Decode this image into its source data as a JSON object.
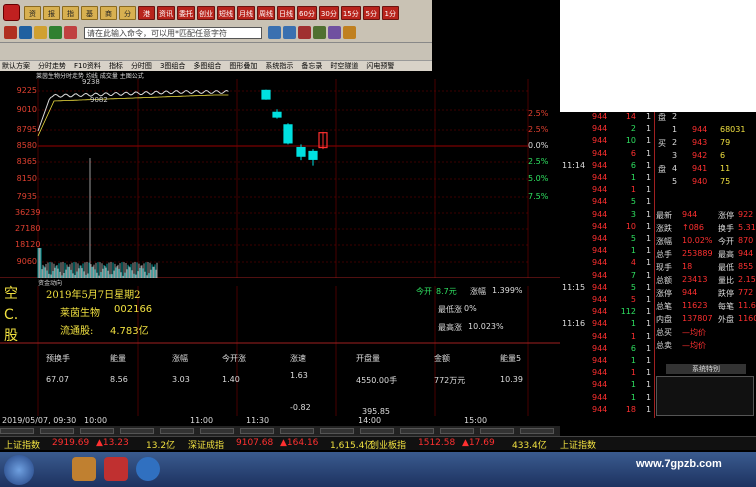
{
  "toolbar": {
    "row1": [
      "资",
      "报",
      "指",
      "基",
      "商",
      "分",
      "港",
      "资讯",
      "委托",
      "创业",
      "短线",
      "月线",
      "周线",
      "日线",
      "60分",
      "30分",
      "15分",
      "5分",
      "1分"
    ],
    "row2_icons": [
      "menu-icon",
      "back-icon",
      "home-icon",
      "search-icon"
    ],
    "command_placeholder": "请在此输入命令，可以用*匹配任意字符"
  },
  "menu": [
    "默认方案",
    "分时走势",
    "F10资料",
    "指标",
    "分时图",
    "3图组合",
    "多图组合",
    "图形叠加",
    "系统指示",
    "备忘录",
    "时空隧道",
    "闪电预警"
  ],
  "chart": {
    "header": "莱茵生物分时走势 均线 成交量 主图公式",
    "price_labels": [
      "9225",
      "9010",
      "8795",
      "8580",
      "8365",
      "8150",
      "7935"
    ],
    "volume_labels": [
      "36239",
      "27180",
      "18120",
      "9060"
    ],
    "pct_labels": [
      "2.5%",
      "2.5%",
      "0.0%",
      "2.5%",
      "5.0%",
      "7.5%"
    ],
    "annotation_top": "9238",
    "annotation_mid": "9082",
    "indicator_row": "资金动向",
    "candles": [
      {
        "open": 9180,
        "close": 9290,
        "high": 9300,
        "low": 9170,
        "up": false
      },
      {
        "open": 9010,
        "close": 8950,
        "high": 9050,
        "low": 8930,
        "up": false
      },
      {
        "open": 8850,
        "close": 8620,
        "high": 8870,
        "low": 8600,
        "up": false
      },
      {
        "open": 8560,
        "close": 8450,
        "high": 8600,
        "low": 8400,
        "up": false
      },
      {
        "open": 8410,
        "close": 8510,
        "high": 8540,
        "low": 8330,
        "up": false
      },
      {
        "open": 8560,
        "close": 8750,
        "high": 8760,
        "low": 8540,
        "up": true
      }
    ]
  },
  "info": {
    "vertical_text": [
      "空",
      "C.",
      "股"
    ],
    "date": "2019年5月7日星期2",
    "stock_name": "莱茵生物",
    "stock_code": "002166",
    "float_label": "流通股:",
    "float_value": "4.783亿",
    "open_label": "今开",
    "open_value": "8.7元",
    "change_label": "涨幅",
    "change_value": "1.399%",
    "low_label": "最低涨",
    "low_value": "0%",
    "high_label": "最高涨",
    "high_value": "10.023%"
  },
  "stats": {
    "headers": [
      "预换手",
      "能量",
      "涨幅",
      "今开涨",
      "涨速",
      "开盘量",
      "金额",
      "能量5"
    ],
    "row1": [
      "67.07",
      "8.56",
      "3.03",
      "1.40",
      "1.63",
      "4550.00手",
      "772万元",
      "10.39"
    ],
    "row2_speed": "-0.82",
    "row2_vol": "395.85"
  },
  "time_axis": [
    "2019/05/07, 09:30",
    "10:00",
    "11:00",
    "11:30",
    "14:00",
    "15:00"
  ],
  "right_panel": {
    "quotes": [
      {
        "p": "944",
        "v": "14",
        "f": "1"
      },
      {
        "p": "944",
        "v": "2",
        "f": "1"
      },
      {
        "p": "944",
        "v": "10",
        "f": "1"
      },
      {
        "p": "944",
        "v": "6",
        "f": "1"
      },
      {
        "p": "944",
        "v": "6",
        "f": "1"
      },
      {
        "p": "944",
        "v": "1",
        "f": "1"
      },
      {
        "p": "944",
        "v": "1",
        "f": "1"
      },
      {
        "p": "944",
        "v": "5",
        "f": "1"
      },
      {
        "p": "944",
        "v": "3",
        "f": "1"
      },
      {
        "p": "944",
        "v": "10",
        "f": "1"
      },
      {
        "p": "944",
        "v": "5",
        "f": "1"
      },
      {
        "p": "944",
        "v": "1",
        "f": "1"
      },
      {
        "p": "944",
        "v": "4",
        "f": "1"
      },
      {
        "p": "944",
        "v": "7",
        "f": "1"
      },
      {
        "p": "944",
        "v": "5",
        "f": "1"
      },
      {
        "p": "944",
        "v": "5",
        "f": "1"
      },
      {
        "p": "944",
        "v": "112",
        "f": "1"
      },
      {
        "p": "944",
        "v": "1",
        "f": "1"
      },
      {
        "p": "944",
        "v": "1",
        "f": "1"
      },
      {
        "p": "944",
        "v": "6",
        "f": "1"
      },
      {
        "p": "944",
        "v": "1",
        "f": "1"
      },
      {
        "p": "944",
        "v": "1",
        "f": "1"
      },
      {
        "p": "944",
        "v": "1",
        "f": "1"
      },
      {
        "p": "944",
        "v": "1",
        "f": "1"
      },
      {
        "p": "944",
        "v": "18",
        "f": "1"
      }
    ],
    "times": [
      "11:14",
      "11:15",
      "11:16"
    ],
    "orders": [
      {
        "l": "盘",
        "n": "2",
        "p": "",
        "v": ""
      },
      {
        "l": "",
        "n": "1",
        "p": "944",
        "v": "68031"
      },
      {
        "l": "买",
        "n": "2",
        "p": "943",
        "v": "79"
      },
      {
        "l": "",
        "n": "3",
        "p": "942",
        "v": "6"
      },
      {
        "l": "盘",
        "n": "4",
        "p": "941",
        "v": "11"
      },
      {
        "l": "",
        "n": "5",
        "p": "940",
        "v": "75"
      }
    ],
    "fields": [
      [
        "最新",
        "944",
        "涨停",
        "922"
      ],
      [
        "涨跌",
        "↑086",
        "换手",
        "5.31%"
      ],
      [
        "涨幅",
        "10.02%",
        "今开",
        "870"
      ],
      [
        "总手",
        "253889",
        "最高",
        "944"
      ],
      [
        "现手",
        "18",
        "最低",
        "855"
      ],
      [
        "总额",
        "23413",
        "量比",
        "2.15"
      ],
      [
        "涨停",
        "944",
        "跌停",
        "772"
      ],
      [
        "总笔",
        "11623",
        "每笔",
        "11.6"
      ],
      [
        "内盘",
        "137807",
        "外盘",
        "116082"
      ],
      [
        "总买",
        "—均价",
        "",
        ""
      ],
      [
        "总卖",
        "—均价",
        "",
        ""
      ]
    ],
    "system_title": "系统特别"
  },
  "index_bar": [
    {
      "name": "上证指数",
      "value": "2919.69",
      "chg": "▲13.23",
      "vol": "13.2亿"
    },
    {
      "name": "深证成指",
      "value": "9107.68",
      "chg": "▲164.16",
      "vol": "1,615.4亿"
    },
    {
      "name": "创业板指",
      "value": "1512.58",
      "chg": "▲17.69",
      "vol": "433.4亿"
    },
    {
      "name": "上证指数",
      "value": "",
      "chg": "",
      "vol": ""
    }
  ],
  "watermark": "www.7gpzb.com",
  "colors": {
    "up": "#ff3030",
    "down": "#00e0e0",
    "grid": "#7a0000",
    "yellow": "#f0e040"
  }
}
